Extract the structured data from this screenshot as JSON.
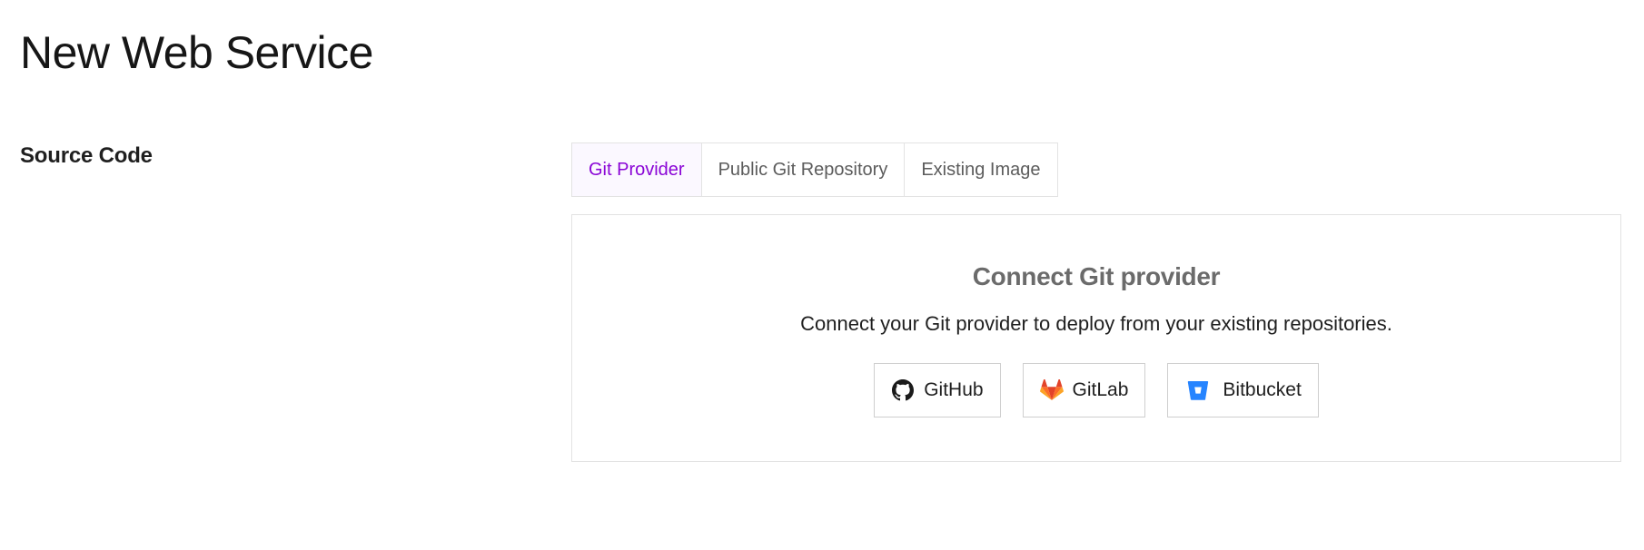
{
  "page": {
    "title": "New Web Service"
  },
  "source_code": {
    "label": "Source Code",
    "tabs": [
      {
        "label": "Git Provider",
        "active": true
      },
      {
        "label": "Public Git Repository",
        "active": false
      },
      {
        "label": "Existing Image",
        "active": false
      }
    ],
    "panel": {
      "heading": "Connect Git provider",
      "description": "Connect your Git provider to deploy from your existing repositories.",
      "providers": [
        {
          "label": "GitHub",
          "icon": "github-icon",
          "color": "#1a1a1a"
        },
        {
          "label": "GitLab",
          "icon": "gitlab-icon",
          "color": "#fc6d26"
        },
        {
          "label": "Bitbucket",
          "icon": "bitbucket-icon",
          "color": "#2684ff"
        }
      ]
    }
  },
  "colors": {
    "accent": "#8a05d6",
    "active_tab_bg": "#fbf8ff",
    "border": "#e3e3e3"
  }
}
